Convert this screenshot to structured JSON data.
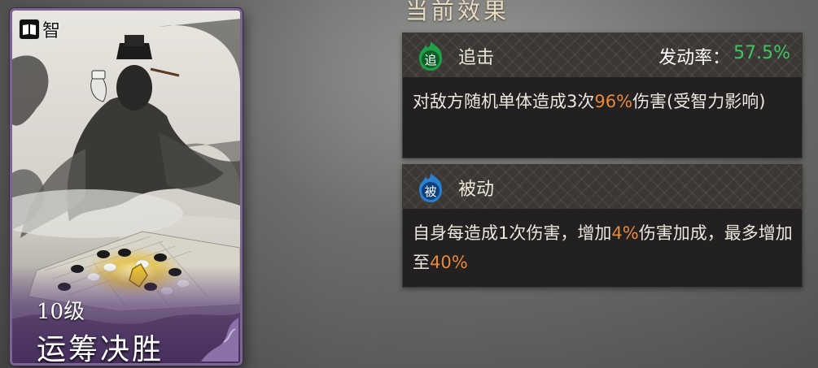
{
  "panel": {
    "title": "当前效果"
  },
  "card": {
    "type_label": "智",
    "level": "10级",
    "name": "运筹决胜",
    "frame_color": "#7a6690"
  },
  "skills": [
    {
      "icon_char": "追",
      "icon_color": "#1fa046",
      "name": "追击",
      "rate_label": "发动率：",
      "rate_value": "57.5%",
      "desc": [
        {
          "t": "对敌方随机单体造成3次",
          "hl": false
        },
        {
          "t": "96%",
          "hl": true
        },
        {
          "t": "伤害(受智力影响)",
          "hl": false
        }
      ]
    },
    {
      "icon_char": "被",
      "icon_color": "#2a7fd0",
      "name": "被动",
      "desc": [
        {
          "t": "自身每造成1次伤害，增加",
          "hl": false
        },
        {
          "t": "4%",
          "hl": true
        },
        {
          "t": "伤害加成，最多增加至",
          "hl": false
        },
        {
          "t": "40%",
          "hl": true
        }
      ]
    }
  ],
  "colors": {
    "highlight": "#e98a3b",
    "rate_green": "#40c460"
  }
}
